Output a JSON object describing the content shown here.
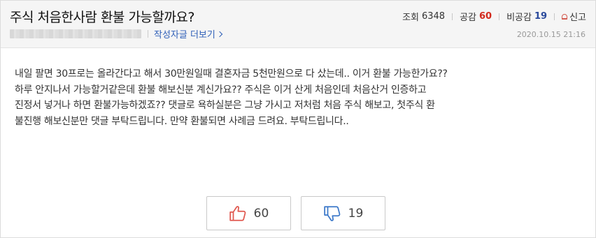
{
  "post": {
    "title": "주식 처음한사람 환불 가능할까요?",
    "date": "2020.10.15 21:16",
    "author_more_link": "작성자글 더보기"
  },
  "stats": {
    "views_label": "조회",
    "views_value": "6348",
    "like_label": "공감",
    "like_value": "60",
    "dislike_label": "비공감",
    "dislike_value": "19",
    "report_label": "신고"
  },
  "body": {
    "lines": [
      "내일 팔면 30프로는 올라간다고 해서 30만원일때 결혼자금 5천만원으로 다 샀는데.. 이거 환불 가능한가요??",
      "하루 안지나서 가능할거같은데 환불 해보신분 계신가요?? 주식은 이거 산게 처음인데 처음산거 인증하고",
      "진정서 넣거나 하면 환불가능하겠죠?? 댓글로 욕하실분은 그냥 가시고 저처럼 처음 주식 해보고, 첫주식 환",
      "불진행 해보신분만 댓글 부탁드립니다. 만약 환불되면 사례금 드려요. 부탁드립니다.."
    ]
  },
  "votes": {
    "like_count": "60",
    "dislike_count": "19"
  },
  "colors": {
    "like": "#d2291c",
    "dislike": "#2b4a9c",
    "link": "#3060b8",
    "like_icon": "#e0584f",
    "dislike_icon": "#3b78c9"
  },
  "icons": {
    "like": "thumbs-up-icon",
    "dislike": "thumbs-down-icon",
    "report": "siren-icon",
    "more": "chevron-right-icon"
  }
}
